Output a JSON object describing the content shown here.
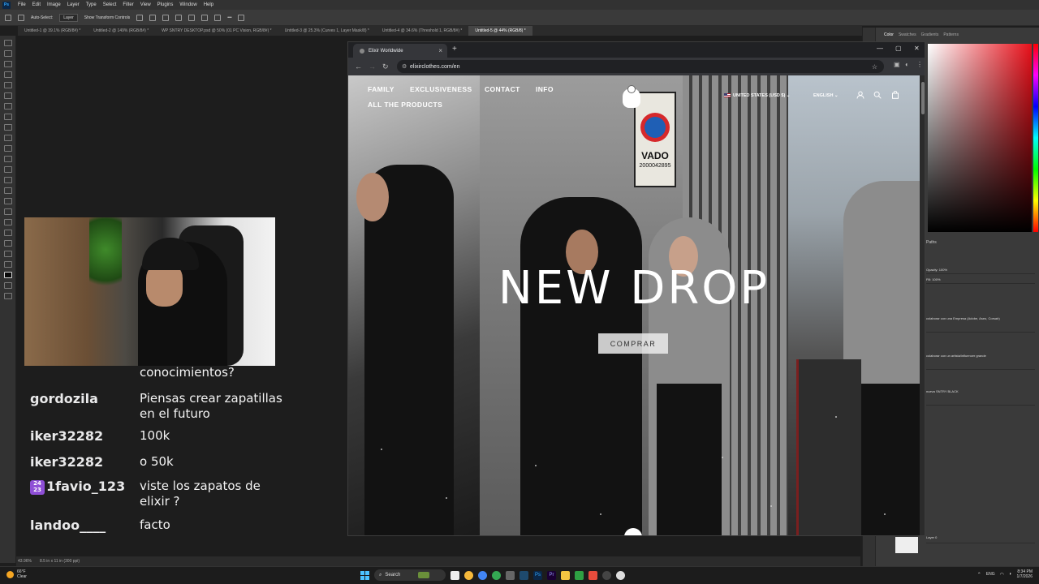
{
  "photoshop": {
    "menus": [
      "File",
      "Edit",
      "Image",
      "Layer",
      "Type",
      "Select",
      "Filter",
      "View",
      "Plugins",
      "Window",
      "Help"
    ],
    "options": {
      "auto_select": "Auto-Select:",
      "auto_select_value": "Layer",
      "transform_controls": "Show Transform Controls"
    },
    "doc_tabs": [
      "Untitled-1 @ 39.1% (RGB/8#) *",
      "Untitled-2 @ 149% (RGB/8#) *",
      "WP SNTRY DESKTOP.psd @ 50% (01 PC Vision, RGB/8#) *",
      "Untitled-3 @ 25.3% (Curves 1, Layer Mask/8) *",
      "Untitled-4 @ 34.6% (Threshold 1, RGB/8#) *",
      "Untitled-5 @ 44% (RGB/8) *"
    ],
    "status": {
      "zoom": "43.96%",
      "doc_size": "8.5 in x 11 in (300 ppi)"
    },
    "panels": {
      "tabs": [
        "Color",
        "Swatches",
        "Gradients",
        "Patterns"
      ],
      "paths_label": "Paths",
      "opacity": "Opacity: 100%",
      "fill": "Fill: 100%",
      "layers": [
        "colaborar con una Empresa (Adobe, Aseo, Corsair)",
        "colaborar con un artista/influencer grande",
        "nueva SNTRY BLACK",
        "Layer 0"
      ]
    }
  },
  "chat": [
    {
      "user": "",
      "message": "conocimientos?"
    },
    {
      "user": "gordozila",
      "message": "Piensas crear zapatillas en el futuro"
    },
    {
      "user": "iker32282",
      "message": "100k"
    },
    {
      "user": "iker32282",
      "message": "o 50k"
    },
    {
      "user": "1favio_123",
      "badge": "24 23",
      "message": "viste los zapatos de elixir ?"
    },
    {
      "user": "landoo____",
      "message": "facto"
    }
  ],
  "browser": {
    "tab_title": "Elixir Worldwide",
    "url": "elixirclothes.com/en",
    "site": {
      "nav": [
        "FAMILY",
        "EXCLUSIVENESS",
        "CONTACT",
        "INFO",
        "ALL THE PRODUCTS"
      ],
      "region": "UNITED STATES (USD $)",
      "language": "ENGLISH",
      "hero_title": "NEW DROP",
      "hero_button": "COMPRAR",
      "sign_text": "VADO",
      "sign_number": "2000042895"
    }
  },
  "taskbar": {
    "temperature": "66°F",
    "weather": "Clear",
    "search_placeholder": "Search",
    "lang": "ENG",
    "time": "8:34 PM",
    "date": "1/7/2026"
  },
  "colors": {
    "ps_blue": "#31a8ff",
    "picker_red": "#e8101a",
    "taskbar_bg": "#1c1c1c"
  }
}
